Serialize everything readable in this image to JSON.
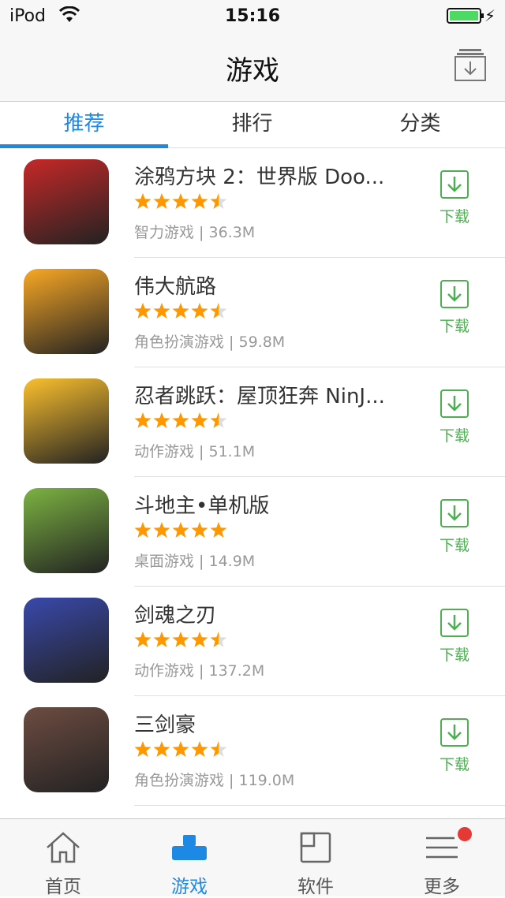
{
  "status_bar": {
    "carrier": "iPod",
    "time": "15:16"
  },
  "nav": {
    "title": "游戏"
  },
  "tabs": [
    {
      "label": "推荐",
      "active": true
    },
    {
      "label": "排行",
      "active": false
    },
    {
      "label": "分类",
      "active": false
    }
  ],
  "download_label": "下载",
  "apps": [
    {
      "name": "涂鸦方块 2：世界版 Doo...",
      "rating": 4.5,
      "meta": "智力游戏 | 36.3M",
      "icon": "doodle-blocks-icon",
      "bg": "#c62828"
    },
    {
      "name": "伟大航路",
      "rating": 4.5,
      "meta": "角色扮演游戏 | 59.8M",
      "icon": "chopper-skull-icon",
      "bg": "#f9a825"
    },
    {
      "name": "忍者跳跃：屋顶狂奔 NinJ...",
      "rating": 4.5,
      "meta": "动作游戏 | 51.1M",
      "icon": "ninja-icon",
      "bg": "#fbc02d"
    },
    {
      "name": "斗地主•单机版",
      "rating": 5,
      "meta": "桌面游戏 | 14.9M",
      "icon": "landlord-face-icon",
      "bg": "#7cb342"
    },
    {
      "name": "剑魂之刃",
      "rating": 4.5,
      "meta": "动作游戏 | 137.2M",
      "icon": "anime-hero-icon",
      "bg": "#3949ab"
    },
    {
      "name": "三剑豪",
      "rating": 4.5,
      "meta": "角色扮演游戏 | 119.0M",
      "icon": "panda-warrior-icon",
      "bg": "#6d4c41"
    }
  ],
  "tabbar": [
    {
      "label": "首页",
      "icon": "home-icon",
      "active": false
    },
    {
      "label": "游戏",
      "icon": "game-icon",
      "active": true
    },
    {
      "label": "软件",
      "icon": "apps-icon",
      "active": false
    },
    {
      "label": "更多",
      "icon": "menu-icon",
      "active": false,
      "badge": true
    }
  ],
  "colors": {
    "accent": "#1e88e5",
    "download": "#4caf50",
    "star": "#ff9800"
  }
}
